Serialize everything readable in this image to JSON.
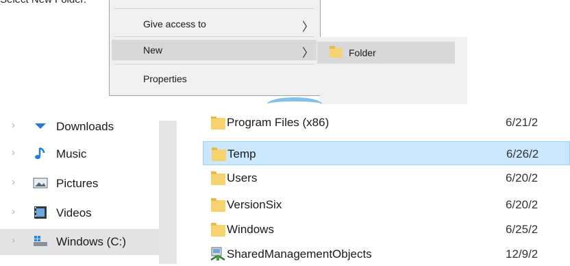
{
  "caption_top": "Select New Folder.",
  "context_menu": {
    "items": [
      {
        "label": "Give access to",
        "has_submenu": true
      },
      {
        "label": "New",
        "has_submenu": true,
        "highlighted": true
      },
      {
        "label": "Properties",
        "has_submenu": false
      }
    ],
    "submenu": {
      "item": "Folder"
    }
  },
  "nav": {
    "items": [
      {
        "label": "Downloads",
        "icon": "download-icon"
      },
      {
        "label": "Music",
        "icon": "music-icon"
      },
      {
        "label": "Pictures",
        "icon": "pictures-icon"
      },
      {
        "label": "Videos",
        "icon": "videos-icon"
      },
      {
        "label": "Windows (C:)",
        "icon": "drive-icon",
        "selected": true
      }
    ]
  },
  "files": {
    "rows": [
      {
        "name": "Program Files (x86)",
        "date": "6/21/2"
      },
      {
        "name": "Temp",
        "date": "6/26/2",
        "selected": true
      },
      {
        "name": "Users",
        "date": "6/20/2"
      },
      {
        "name": "VersionSix",
        "date": "6/20/2"
      },
      {
        "name": "Windows",
        "date": "6/25/2"
      },
      {
        "name": "SharedManagementObjects",
        "date": "12/9/2"
      }
    ]
  }
}
